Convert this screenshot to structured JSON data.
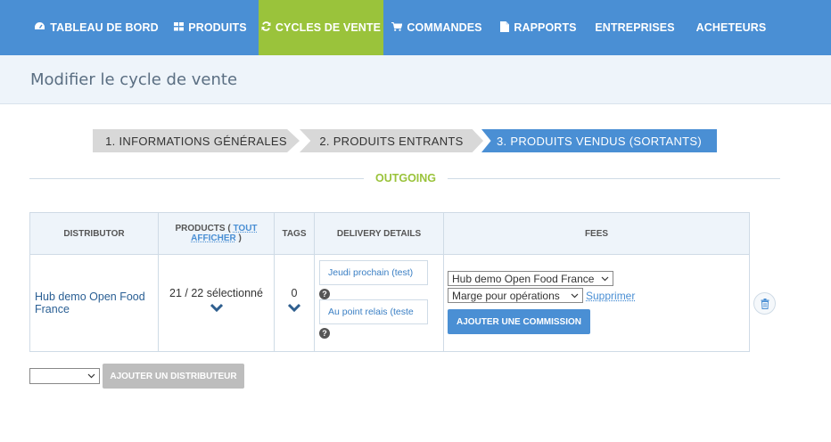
{
  "nav": {
    "items": [
      {
        "label": "TABLEAU DE BORD",
        "icon": "dashboard-icon"
      },
      {
        "label": "PRODUITS",
        "icon": "grid-icon"
      },
      {
        "label": "CYCLES DE VENTE",
        "icon": "refresh-icon"
      },
      {
        "label": "COMMANDES",
        "icon": "cart-icon"
      },
      {
        "label": "RAPPORTS",
        "icon": "file-icon"
      },
      {
        "label": "ENTREPRISES",
        "icon": ""
      },
      {
        "label": "ACHETEURS",
        "icon": ""
      }
    ]
  },
  "page": {
    "title": "Modifier le cycle de vente"
  },
  "wizard": {
    "step1": "1. INFORMATIONS GÉNÉRALES",
    "step2": "2. PRODUITS ENTRANTS",
    "step3": "3. PRODUITS VENDUS (SORTANTS)"
  },
  "section": {
    "title": "OUTGOING"
  },
  "table": {
    "headers": {
      "distributor": "DISTRIBUTOR",
      "products_prefix": "PRODUCTS (",
      "products_link": "TOUT AFFICHER",
      "products_suffix": ")",
      "tags": "TAGS",
      "delivery": "DELIVERY DETAILS",
      "fees": "FEES"
    },
    "row": {
      "distributor": "Hub demo Open Food France",
      "products": "21 / 22 sélectionné",
      "tags": "0",
      "pickup_time": "Jeudi prochain (test)",
      "pickup_instructions": "Au point relais (teste",
      "fee_enterprise": "Hub demo Open Food France",
      "fee_name": "Marge pour opérations",
      "remove_fee": "Supprimer",
      "add_fee": "AJOUTER UNE COMMISSION"
    }
  },
  "footer": {
    "distributor_select": "",
    "add_distributor": "AJOUTER UN DISTRIBUTEUR"
  },
  "colors": {
    "nav": "#4a8fd4",
    "active": "#9ac33b",
    "header_bg": "#eef4fa"
  }
}
